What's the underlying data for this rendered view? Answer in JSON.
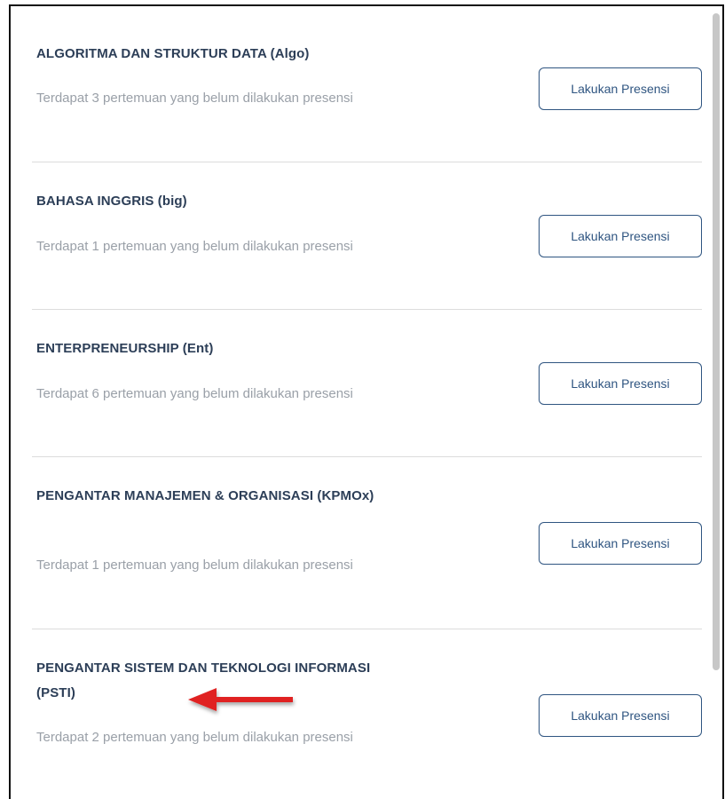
{
  "courses": [
    {
      "title": "ALGORITMA DAN STRUKTUR DATA (Algo)",
      "description": "Terdapat 3 pertemuan yang belum dilakukan presensi",
      "button_label": "Lakukan Presensi"
    },
    {
      "title": "BAHASA INGGRIS (big)",
      "description": "Terdapat 1 pertemuan yang belum dilakukan presensi",
      "button_label": "Lakukan Presensi"
    },
    {
      "title": "ENTERPRENEURSHIP (Ent)",
      "description": "Terdapat 6 pertemuan yang belum dilakukan presensi",
      "button_label": "Lakukan Presensi"
    },
    {
      "title": "PENGANTAR MANAJEMEN & ORGANISASI (KPMOx)",
      "description": "Terdapat 1 pertemuan yang belum dilakukan presensi",
      "button_label": "Lakukan Presensi"
    },
    {
      "title": "PENGANTAR SISTEM DAN TEKNOLOGI INFORMASI (PSTI)",
      "description": "Terdapat 2 pertemuan yang belum dilakukan presensi",
      "button_label": "Lakukan Presensi"
    }
  ],
  "colors": {
    "title": "#2c3e57",
    "description": "#9aa0a8",
    "button_border": "#2f5581",
    "annotation_arrow": "#e02020"
  },
  "icons": {
    "annotation": "red-arrow-left-icon"
  }
}
